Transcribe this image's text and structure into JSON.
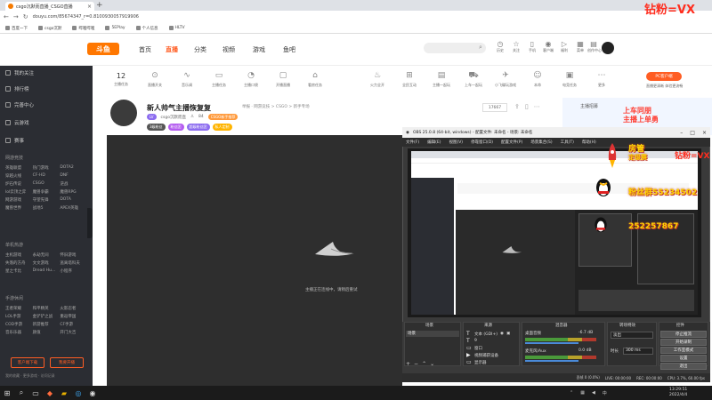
{
  "browser": {
    "tab_title": "csgo沉默而直播_CSGO直播",
    "new_tab": "+",
    "url": "douyu.com/85674347_r=0.8100930057919906",
    "bookmarks": [
      "百度一下",
      "csgo沉默",
      "哔哩哔哩",
      "5EPlay",
      "个人信息",
      "HLTV"
    ]
  },
  "site": {
    "logo": "斗鱼",
    "nav": [
      "首页",
      "直播",
      "分类",
      "视频",
      "游戏",
      "鱼吧"
    ],
    "top_icons": [
      {
        "icon": "clock-icon",
        "label": "历史"
      },
      {
        "icon": "star-icon",
        "label": "关注"
      },
      {
        "icon": "phone-icon",
        "label": "手机"
      },
      {
        "icon": "user-icon",
        "label": "客户端"
      },
      {
        "icon": "play-icon",
        "label": "福利"
      },
      {
        "icon": "grid-icon",
        "label": "菜单"
      },
      {
        "icon": "doc-icon",
        "label": "创作中心"
      }
    ]
  },
  "sidebar": {
    "items": [
      "我的关注",
      "排行榜",
      "完善中心",
      "云游戏",
      "赛事"
    ],
    "sections": [
      {
        "title": "网游竞技",
        "games": [
          "英雄联盟",
          "热门游戏",
          "DOTA2",
          "穿越火线",
          "CF-HD",
          "DNF",
          "炉石传说",
          "CSGO",
          "逆战",
          "lol云顶之弈",
          "魔兽争霸",
          "魔兽RPG",
          "网游游戏",
          "守望先锋",
          "DOTA",
          "魔兽世界",
          "战地5",
          "APEX英雄"
        ]
      },
      {
        "title": "单机热游",
        "games": [
          "主机游戏",
          "永劫无间",
          "怀旧游戏",
          "失落的方舟",
          "文文游戏",
          "逃离塔科夫",
          "星之卡比",
          "Dread Hu...",
          "小程序"
        ]
      },
      {
        "title": "手游休闲",
        "games": [
          "王者荣耀",
          "和平精英",
          "火影忍者",
          "LOL手游",
          "金铲铲之战",
          "重返帝国",
          "COD手游",
          "新游推荐",
          "CF手游",
          "音乐乐器",
          "颜值",
          "开门大吉"
        ]
      }
    ],
    "btn_client": "客户端下载",
    "btn_start": "我要开播",
    "bottom_text": "我的收藏 · 更多游戏 · 访问记录"
  },
  "categories": {
    "count": "12",
    "count_label": "主播任务",
    "items": [
      "直播开关",
      "音乐调",
      "主播任务",
      "主播口袋",
      "开播直播",
      "看房任务",
      "火力全开",
      "全民互动",
      "主播一起玩",
      "上车一起玩",
      "小飞碟玩游戏",
      "本命",
      "电竞任务",
      "更多"
    ],
    "pc_btn": "PC客户端",
    "pc_label": "直播更清晰 体验更流畅"
  },
  "room": {
    "title": "新人帅气主播恢复复",
    "tags": "举报 · 网游竞技 > CSGO > 新手专场",
    "streamer": "csgo沉默而直",
    "level": "LV",
    "meta_count": "84",
    "meta_tag": "CSGO新手推荐",
    "follow": "17667",
    "badges": [
      "3级粉丝",
      "粉丝团",
      "超级粉丝团",
      "私人定制"
    ],
    "loading_text": "主播正在连线中，请稍后重试"
  },
  "right_ad": {
    "label": "主播招募",
    "line1": "上车同朋",
    "line2": "主播上单勇",
    "title": "我要开播"
  },
  "obs": {
    "title": "OBS 25.0.8 (64-bit, windows) - 配置文件: 未命名 - 场景: 未命名",
    "menu": [
      "文件(F)",
      "编辑(E)",
      "视图(V)",
      "停靠窗口(D)",
      "配置文件(P)",
      "场景集合(S)",
      "工具(T)",
      "帮助(H)"
    ],
    "docks": [
      "场景",
      "来源",
      "混音器",
      "转场特效",
      "控件"
    ],
    "scene": "场景",
    "sources": [
      "文本 (GDI+)",
      "9",
      "窗口",
      "视频捕获设备",
      "显示器"
    ],
    "mixer": [
      {
        "name": "桌面音频",
        "db": "-6.7 dB"
      },
      {
        "name": "麦克风/Aux",
        "db": "0.0 dB"
      }
    ],
    "transition": "淡出",
    "duration_label": "时长",
    "duration": "300 ms",
    "controls": [
      "停止推流",
      "开始录制",
      "工作室模式",
      "设置",
      "退出"
    ],
    "status": [
      "丢帧 0 (0.0%)",
      "LIVE: 00:00:00",
      "REC: 00:00:00",
      "CPU: 3.7%, 60.00 fps"
    ]
  },
  "overlays": {
    "vx_top": "钻粉=VX",
    "vx_obs": "钻粉=VX",
    "fan1": "房管",
    "fan2": "定级赛",
    "qq1": "粉丝群55234502",
    "qq2": "252257867"
  },
  "taskbar": {
    "time": "13:29:51",
    "date": "2022/4/4"
  },
  "colors": {
    "accent": "#ff5d23",
    "sidebar_bg": "#2b2d33",
    "video_bg": "#2e2e2e",
    "obs_bg": "#3a3a3a",
    "overlay_red": "#ff2d1e",
    "overlay_yellow": "#ffd400"
  }
}
